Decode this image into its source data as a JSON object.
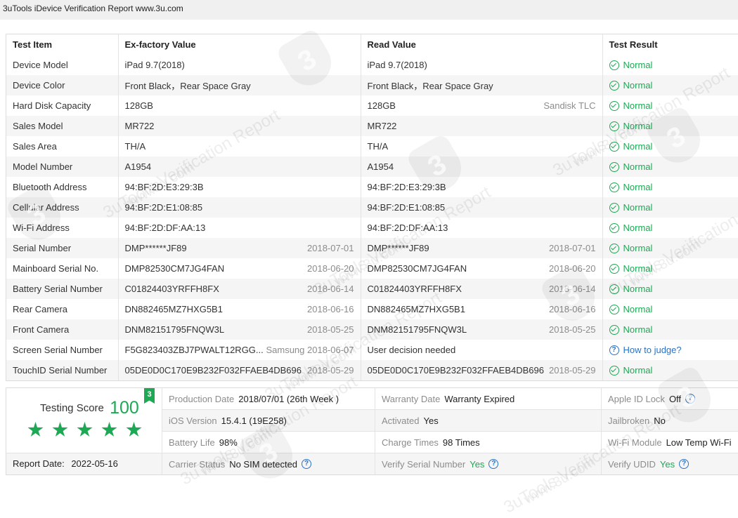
{
  "window": {
    "title": "3uTools iDevice Verification Report www.3u.com"
  },
  "table": {
    "headers": [
      "Test Item",
      "Ex-factory Value",
      "Read Value",
      "Test Result"
    ],
    "rows": [
      {
        "item": "Device Model",
        "ex": "iPad 9.7(2018)",
        "ex_sub": "",
        "read": "iPad 9.7(2018)",
        "read_sub": "",
        "result": "Normal",
        "status": "ok"
      },
      {
        "item": "Device Color",
        "ex": "Front Black，Rear Space Gray",
        "ex_sub": "",
        "read": "Front Black，Rear Space Gray",
        "read_sub": "",
        "result": "Normal",
        "status": "ok"
      },
      {
        "item": "Hard Disk Capacity",
        "ex": "128GB",
        "ex_sub": "",
        "read": "128GB",
        "read_sub": "Sandisk TLC",
        "result": "Normal",
        "status": "ok"
      },
      {
        "item": "Sales Model",
        "ex": "MR722",
        "ex_sub": "",
        "read": "MR722",
        "read_sub": "",
        "result": "Normal",
        "status": "ok"
      },
      {
        "item": "Sales Area",
        "ex": "TH/A",
        "ex_sub": "",
        "read": "TH/A",
        "read_sub": "",
        "result": "Normal",
        "status": "ok"
      },
      {
        "item": "Model Number",
        "ex": "A1954",
        "ex_sub": "",
        "read": "A1954",
        "read_sub": "",
        "result": "Normal",
        "status": "ok"
      },
      {
        "item": "Bluetooth Address",
        "ex": "94:BF:2D:E3:29:3B",
        "ex_sub": "",
        "read": "94:BF:2D:E3:29:3B",
        "read_sub": "",
        "result": "Normal",
        "status": "ok"
      },
      {
        "item": "Cellular Address",
        "ex": "94:BF:2D:E1:08:85",
        "ex_sub": "",
        "read": "94:BF:2D:E1:08:85",
        "read_sub": "",
        "result": "Normal",
        "status": "ok"
      },
      {
        "item": "Wi-Fi Address",
        "ex": "94:BF:2D:DF:AA:13",
        "ex_sub": "",
        "read": "94:BF:2D:DF:AA:13",
        "read_sub": "",
        "result": "Normal",
        "status": "ok"
      },
      {
        "item": "Serial Number",
        "ex": "DMP******JF89",
        "ex_sub": "2018-07-01",
        "read": "DMP******JF89",
        "read_sub": "2018-07-01",
        "result": "Normal",
        "status": "ok"
      },
      {
        "item": "Mainboard Serial No.",
        "ex": "DMP82530CM7JG4FAN",
        "ex_sub": "2018-06-20",
        "read": "DMP82530CM7JG4FAN",
        "read_sub": "2018-06-20",
        "result": "Normal",
        "status": "ok"
      },
      {
        "item": "Battery Serial Number",
        "ex": "C01824403YRFFH8FX",
        "ex_sub": "2018-06-14",
        "read": "C01824403YRFFH8FX",
        "read_sub": "2018-06-14",
        "result": "Normal",
        "status": "ok"
      },
      {
        "item": "Rear Camera",
        "ex": "DN882465MZ7HXG5B1",
        "ex_sub": "2018-06-16",
        "read": "DN882465MZ7HXG5B1",
        "read_sub": "2018-06-16",
        "result": "Normal",
        "status": "ok"
      },
      {
        "item": "Front Camera",
        "ex": "DNM82151795FNQW3L",
        "ex_sub": "2018-05-25",
        "read": "DNM82151795FNQW3L",
        "read_sub": "2018-05-25",
        "result": "Normal",
        "status": "ok"
      },
      {
        "item": "Screen Serial Number",
        "ex": "F5G823403ZBJ7PWALT12RGG...",
        "ex_sub": "Samsung 2018-06-07",
        "read": "User decision needed",
        "read_sub": "",
        "result": "How to judge?",
        "status": "judge"
      },
      {
        "item": "TouchID Serial Number",
        "ex": "05DE0D0C170E9B232F032FFAEB4DB696",
        "ex_sub": "2018-05-29",
        "read": "05DE0D0C170E9B232F032FFAEB4DB696",
        "read_sub": "2018-05-29",
        "result": "Normal",
        "status": "ok"
      }
    ]
  },
  "summary": {
    "score_label": "Testing Score",
    "score": "100",
    "badge": "3",
    "stars": 5,
    "report_date_label": "Report Date:",
    "report_date": "2022-05-16",
    "cells": [
      {
        "label": "Production Date",
        "value": "2018/07/01 (26th Week )",
        "value_style": "val",
        "help": false
      },
      {
        "label": "Warranty Date",
        "value": "Warranty Expired",
        "value_style": "val",
        "help": false
      },
      {
        "label": "Apple ID Lock",
        "value": "Off",
        "value_style": "val",
        "help": true
      },
      {
        "label": "iOS Version",
        "value": "15.4.1 (19E258)",
        "value_style": "val",
        "help": false
      },
      {
        "label": "Activated",
        "value": "Yes",
        "value_style": "val",
        "help": false
      },
      {
        "label": "Jailbroken",
        "value": "No",
        "value_style": "val",
        "help": false
      },
      {
        "label": "Battery Life",
        "value": "98%",
        "value_style": "val",
        "help": false
      },
      {
        "label": "Charge Times",
        "value": "98 Times",
        "value_style": "val",
        "help": false
      },
      {
        "label": "Wi-Fi Module",
        "value": "Low Temp Wi-Fi",
        "value_style": "val",
        "help": false
      },
      {
        "label": "Carrier Status",
        "value": "No SIM detected",
        "value_style": "val",
        "help": true
      },
      {
        "label": "Verify Serial Number",
        "value": "Yes",
        "value_style": "valg",
        "help": true
      },
      {
        "label": "Verify UDID",
        "value": "Yes",
        "value_style": "valg",
        "help": true
      }
    ]
  },
  "watermark": {
    "line1": "3uTools Verification Report",
    "line2": "www.3u.com",
    "logo_glyph": "3"
  },
  "colors": {
    "accent": "#1da854",
    "link": "#2a72c6"
  }
}
